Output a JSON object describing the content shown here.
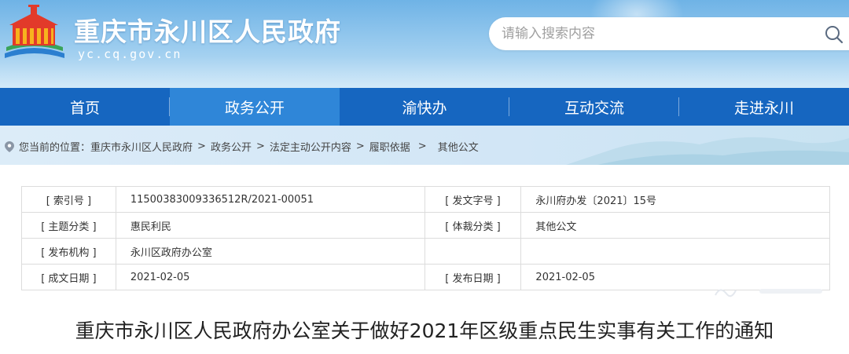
{
  "header": {
    "site_title": "重庆市永川区人民政府",
    "site_domain": "yc.cq.gov.cn",
    "logo_icon": "government-emblem-icon",
    "search": {
      "placeholder": "请输入搜索内容",
      "icon": "search-icon"
    }
  },
  "nav": {
    "items": [
      {
        "label": "首页",
        "active": false
      },
      {
        "label": "政务公开",
        "active": true
      },
      {
        "label": "渝快办",
        "active": false
      },
      {
        "label": "互动交流",
        "active": false
      },
      {
        "label": "走进永川",
        "active": false
      }
    ]
  },
  "breadcrumb": {
    "prefix": "您当前的位置：",
    "items": [
      "重庆市永川区人民政府",
      "政务公开",
      "法定主动公开内容",
      "履职依据",
      "其他公文"
    ],
    "separator": ">"
  },
  "info_table": {
    "rows": [
      {
        "label1": "[ 索引号 ]",
        "value1": "11500383009336512R/2021-00051",
        "label2": "[ 发文字号 ]",
        "value2": "永川府办发〔2021〕15号"
      },
      {
        "label1": "[ 主题分类 ]",
        "value1": "惠民利民",
        "label2": "[ 体裁分类 ]",
        "value2": "其他公文"
      },
      {
        "label1": "[ 发布机构 ]",
        "value1": "永川区政府办公室",
        "label2": "",
        "value2": ""
      },
      {
        "label1": "[ 成文日期 ]",
        "value1": "2021-02-05",
        "label2": "[ 发布日期 ]",
        "value2": "2021-02-05"
      }
    ]
  },
  "document": {
    "title": "重庆市永川区人民政府办公室关于做好2021年区级重点民生实事有关工作的通知"
  },
  "colors": {
    "nav_bg": "#1666c0",
    "nav_active": "#2f86d8",
    "header_bg": "#8cc4ec"
  }
}
